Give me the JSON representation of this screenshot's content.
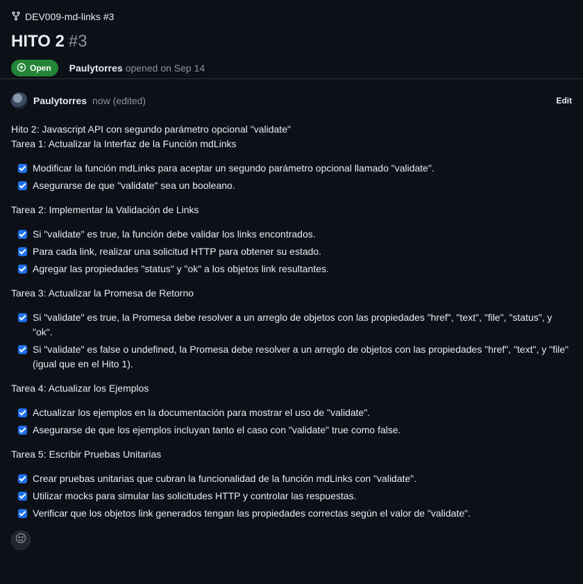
{
  "header": {
    "repo_link": "DEV009-md-links #3",
    "title": "HITO 2",
    "number": "#3",
    "status": "Open",
    "author": "Paulytorres",
    "opened_text": "opened on Sep 14"
  },
  "comment": {
    "author": "Paulytorres",
    "time": "now (edited)",
    "edit_label": "Edit",
    "intro_lines": [
      "Hito 2: Javascript API con segundo parámetro opcional \"validate\"",
      "Tarea 1: Actualizar la Interfaz de la Función mdLinks"
    ],
    "sections": [
      {
        "title": "",
        "tasks": [
          "Modificar la función mdLinks para aceptar un segundo parámetro opcional llamado \"validate\".",
          "Asegurarse de que \"validate\" sea un booleano."
        ]
      },
      {
        "title": "Tarea 2: Implementar la Validación de Links",
        "tasks": [
          "Si \"validate\" es true, la función debe validar los links encontrados.",
          "Para cada link, realizar una solicitud HTTP para obtener su estado.",
          "Agregar las propiedades \"status\" y \"ok\" a los objetos link resultantes."
        ]
      },
      {
        "title": "Tarea 3: Actualizar la Promesa de Retorno",
        "tasks": [
          "Si \"validate\" es true, la Promesa debe resolver a un arreglo de objetos con las propiedades \"href\", \"text\", \"file\", \"status\", y \"ok\".",
          "Si \"validate\" es false o undefined, la Promesa debe resolver a un arreglo de objetos con las propiedades \"href\", \"text\", y \"file\" (igual que en el Hito 1)."
        ]
      },
      {
        "title": "Tarea 4: Actualizar los Ejemplos",
        "tasks": [
          "Actualizar los ejemplos en la documentación para mostrar el uso de \"validate\".",
          "Asegurarse de que los ejemplos incluyan tanto el caso con \"validate\" true como false."
        ]
      },
      {
        "title": "Tarea 5: Escribir Pruebas Unitarias",
        "tasks": [
          "Crear pruebas unitarias que cubran la funcionalidad de la función mdLinks con \"validate\".",
          "Utilizar mocks para simular las solicitudes HTTP y controlar las respuestas.",
          "Verificar que los objetos link generados tengan las propiedades correctas según el valor de \"validate\"."
        ]
      }
    ]
  },
  "colors": {
    "accent": "#1f6feb",
    "open_green": "#238636",
    "background": "#0d1117"
  }
}
